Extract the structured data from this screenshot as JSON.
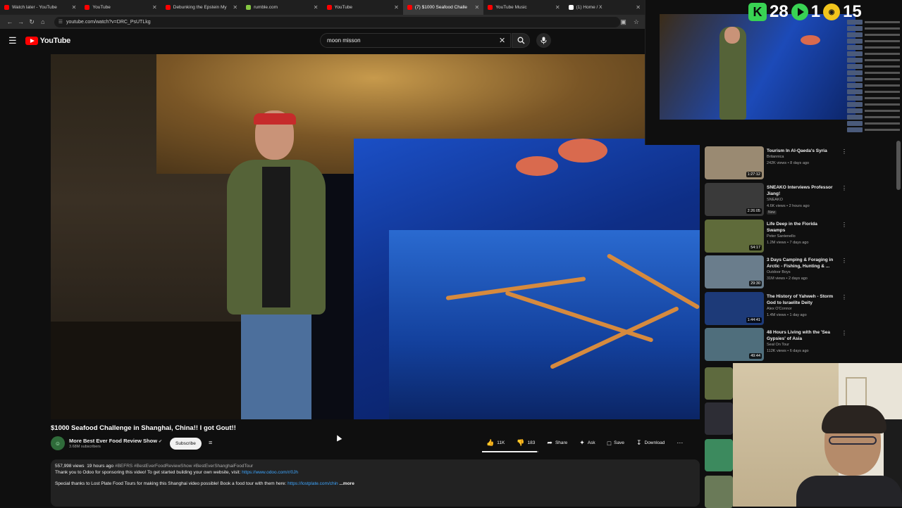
{
  "browser": {
    "tabs": [
      {
        "label": "Watch later - YouTube",
        "color": "#ff0000",
        "active": false
      },
      {
        "label": "YouTube",
        "color": "#ff0000",
        "active": false
      },
      {
        "label": "Debunking the Epstein My",
        "color": "#ff0000",
        "active": false
      },
      {
        "label": "rumble.com",
        "color": "#85c742",
        "active": false
      },
      {
        "label": "YouTube",
        "color": "#ff0000",
        "active": false
      },
      {
        "label": "(7) $1000 Seafood Challe",
        "color": "#ff0000",
        "active": true
      },
      {
        "label": "YouTube Music",
        "color": "#ff0000",
        "active": false
      },
      {
        "label": "(1) Home / X",
        "color": "#ffffff",
        "active": false
      }
    ],
    "url": "youtube.com/watch?v=DRC_PsUTLkg"
  },
  "header": {
    "logo_text": "YouTube",
    "search_value": "moon misson"
  },
  "video": {
    "title": "$1000 Seafood Challenge in Shanghai, China!! I got Gout!!",
    "channel_name": "More Best Ever Food Review Show",
    "subscribers": "3.68M subscribers",
    "subscribe_label": "Subscribe",
    "likes": "11K",
    "dislikes": "183",
    "like_ratio": 0.98,
    "share_label": "Share",
    "ask_label": "Ask",
    "save_label": "Save",
    "download_label": "Download"
  },
  "description": {
    "views": "557,998 views",
    "age": "19 hours ago",
    "tags": "#BEFRS #BestEverFoodReviewShow #BestEverShanghaiFoodTour",
    "line1_text": "Thank you to Odoo for sponsoring this video! To get started building your own website, visit:",
    "line1_link": "https://www.odoo.com/r/0Jh",
    "line2_text": "Special thanks to Lost Plate Food Tours for making this Shanghai video possible! Book a food tour with them here:",
    "line2_link": "https://lostplate.com/chin",
    "more_label": "...more"
  },
  "recommendations": [
    {
      "title": "Tourism In Al-Qaeda's Syria",
      "channel": "Britannica",
      "meta": "242K views • 8 days ago",
      "duration": "1:27:12",
      "new": false,
      "thumb_color": "#9a8a72"
    },
    {
      "title": "SNEAKO Interviews Professor Jiang!",
      "channel": "SNEAKO",
      "meta": "4.6K views • 2 hours ago",
      "duration": "2:26:05",
      "new": true,
      "new_label": "New",
      "thumb_color": "#3a3a3a"
    },
    {
      "title": "Life Deep in the Florida Swamps",
      "channel": "Peter Santenello",
      "meta": "1.2M views • 7 days ago",
      "duration": "54:17",
      "new": false,
      "thumb_color": "#5f6b3a"
    },
    {
      "title": "3 Days Camping & Foraging in Arctic - Fishing, Hunting & ...",
      "channel": "Outdoor Boys",
      "meta": "31M views • 2 days ago",
      "duration": "29:30",
      "new": false,
      "thumb_color": "#6a7d8c"
    },
    {
      "title": "The History of Yahweh - Storm God to Israelite Deity",
      "channel": "Alex O'Connor",
      "meta": "1.4M views • 1 day ago",
      "duration": "1:44:41",
      "new": false,
      "thumb_color": "#1d3a78"
    },
    {
      "title": "48 Hours Living with the 'Sea Gypsies' of Asia",
      "channel": "Seal On Tour",
      "meta": "112K views • 6 days ago",
      "duration": "49:44",
      "new": false,
      "thumb_color": "#4f6e7c"
    }
  ],
  "overlay": {
    "score_a": "28",
    "score_b": "1",
    "score_c": "15"
  },
  "colors": {
    "accent": "#ff0000",
    "link": "#3ea6ff",
    "background": "#0f0f0f"
  }
}
